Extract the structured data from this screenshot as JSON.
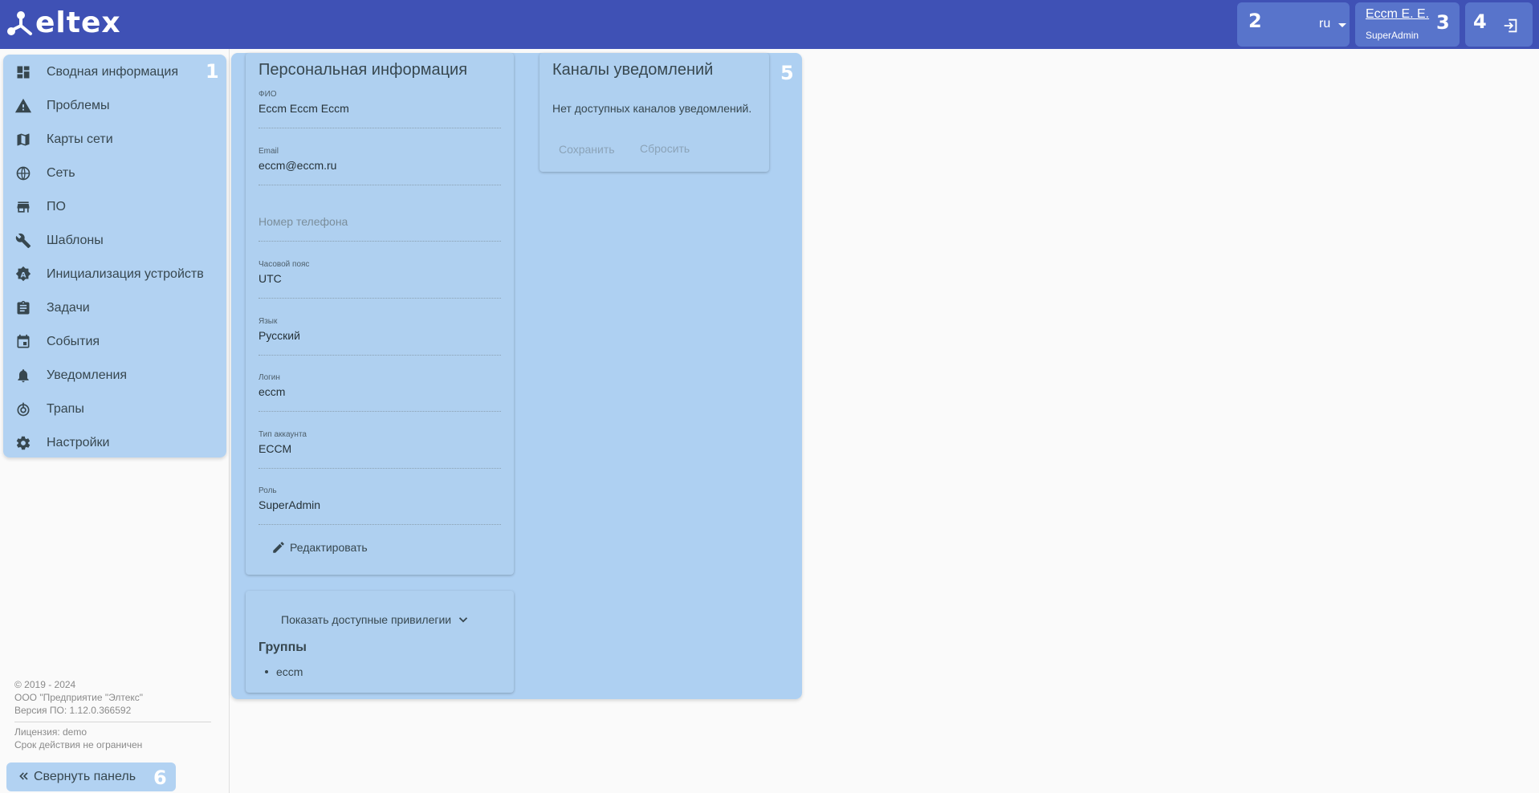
{
  "header": {
    "logo_text": "eltex",
    "language": "ru",
    "user_name": "Eccm E. E.",
    "user_role": "SuperAdmin",
    "callouts": [
      "1",
      "2",
      "3",
      "4",
      "5",
      "6"
    ]
  },
  "sidebar": {
    "items": [
      {
        "label": "Сводная информация",
        "icon": "dashboard-icon"
      },
      {
        "label": "Проблемы",
        "icon": "warning-icon"
      },
      {
        "label": "Карты сети",
        "icon": "map-icon"
      },
      {
        "label": "Сеть",
        "icon": "globe-icon"
      },
      {
        "label": "ПО",
        "icon": "store-icon"
      },
      {
        "label": "Шаблоны",
        "icon": "wrench-icon"
      },
      {
        "label": "Инициализация устройств",
        "icon": "auto-fix-icon"
      },
      {
        "label": "Задачи",
        "icon": "clipboard-icon"
      },
      {
        "label": "События",
        "icon": "calendar-icon"
      },
      {
        "label": "Уведомления",
        "icon": "bell-icon"
      },
      {
        "label": "Трапы",
        "icon": "trap-icon"
      },
      {
        "label": "Настройки",
        "icon": "gear-icon"
      }
    ],
    "footer": {
      "copyright": "© 2019 - 2024",
      "company": "ООО \"Предприятие \"Элтекс\"",
      "version": "Версия ПО: 1.12.0.366592",
      "license": "Лицензия: demo",
      "validity": "Срок действия не ограничен"
    },
    "collapse_label": "Свернуть панель"
  },
  "personal": {
    "title": "Персональная информация",
    "fields": [
      {
        "label": "ФИО",
        "value": "Eccm Eccm Eccm"
      },
      {
        "label": "Email",
        "value": "eccm@eccm.ru"
      },
      {
        "label": "",
        "value": "",
        "placeholder": "Номер телефона"
      },
      {
        "label": "Часовой пояс",
        "value": "UTC"
      },
      {
        "label": "Язык",
        "value": "Русский"
      },
      {
        "label": "Логин",
        "value": "eccm"
      },
      {
        "label": "Тип аккаунта",
        "value": "ECCM"
      },
      {
        "label": "Роль",
        "value": "SuperAdmin"
      }
    ],
    "edit_label": "Редактировать"
  },
  "privileges": {
    "show_label": "Показать доступные привилегии",
    "groups_title": "Группы",
    "groups": [
      "eccm"
    ]
  },
  "notifications": {
    "title": "Каналы уведомлений",
    "empty_text": "Нет доступных каналов уведомлений.",
    "save_label": "Сохранить",
    "reset_label": "Сбросить"
  },
  "colors": {
    "header_bg": "#3f51b5",
    "highlight": "#a0c8f0",
    "text": "#37474f"
  }
}
